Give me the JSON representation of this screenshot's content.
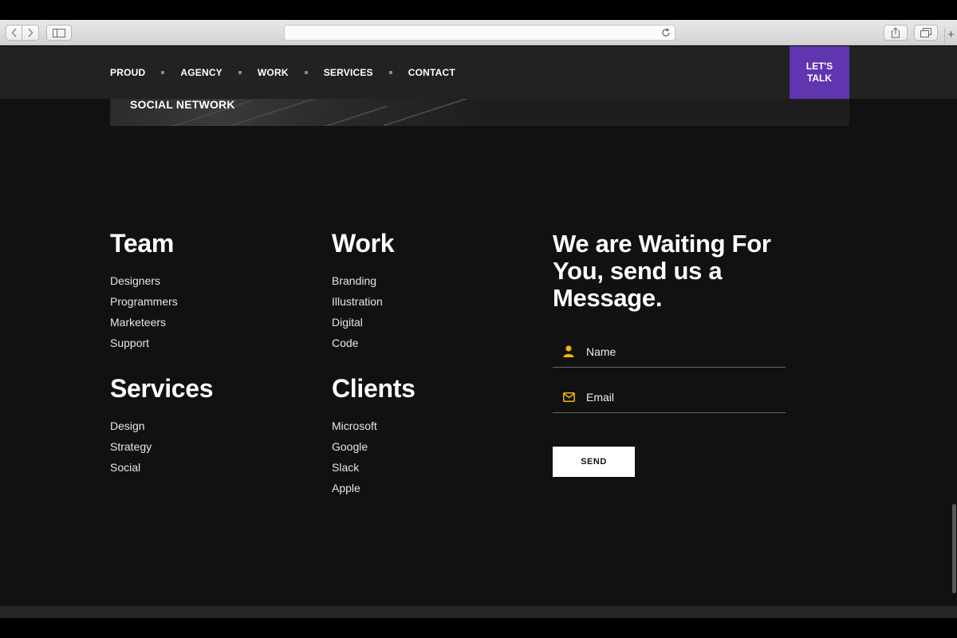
{
  "header": {
    "nav": [
      "PROUD",
      "AGENCY",
      "WORK",
      "SERVICES",
      "CONTACT"
    ],
    "cta_line1": "LET'S",
    "cta_line2": "TALK"
  },
  "hero": {
    "caption": "SOCIAL NETWORK"
  },
  "columns": {
    "team": {
      "title": "Team",
      "items": [
        "Designers",
        "Programmers",
        "Marketeers",
        "Support"
      ]
    },
    "work": {
      "title": "Work",
      "items": [
        "Branding",
        "Illustration",
        "Digital",
        "Code"
      ]
    },
    "services": {
      "title": "Services",
      "items": [
        "Design",
        "Strategy",
        "Social"
      ]
    },
    "clients": {
      "title": "Clients",
      "items": [
        "Microsoft",
        "Google",
        "Slack",
        "Apple"
      ]
    }
  },
  "contact": {
    "title": "We are Waiting For You, send us a Message.",
    "name_label": "Name",
    "email_label": "Email",
    "send_label": "SEND"
  },
  "colors": {
    "accent": "#5f35b0",
    "icon": "#f5b800",
    "background": "#111111",
    "header": "#222222"
  },
  "icons": {
    "name_field": "user-icon",
    "email_field": "envelope-icon",
    "browser_back": "chevron-left-icon",
    "browser_forward": "chevron-right-icon",
    "reload": "reload-icon",
    "share": "share-icon",
    "tabs": "tabs-icon"
  }
}
